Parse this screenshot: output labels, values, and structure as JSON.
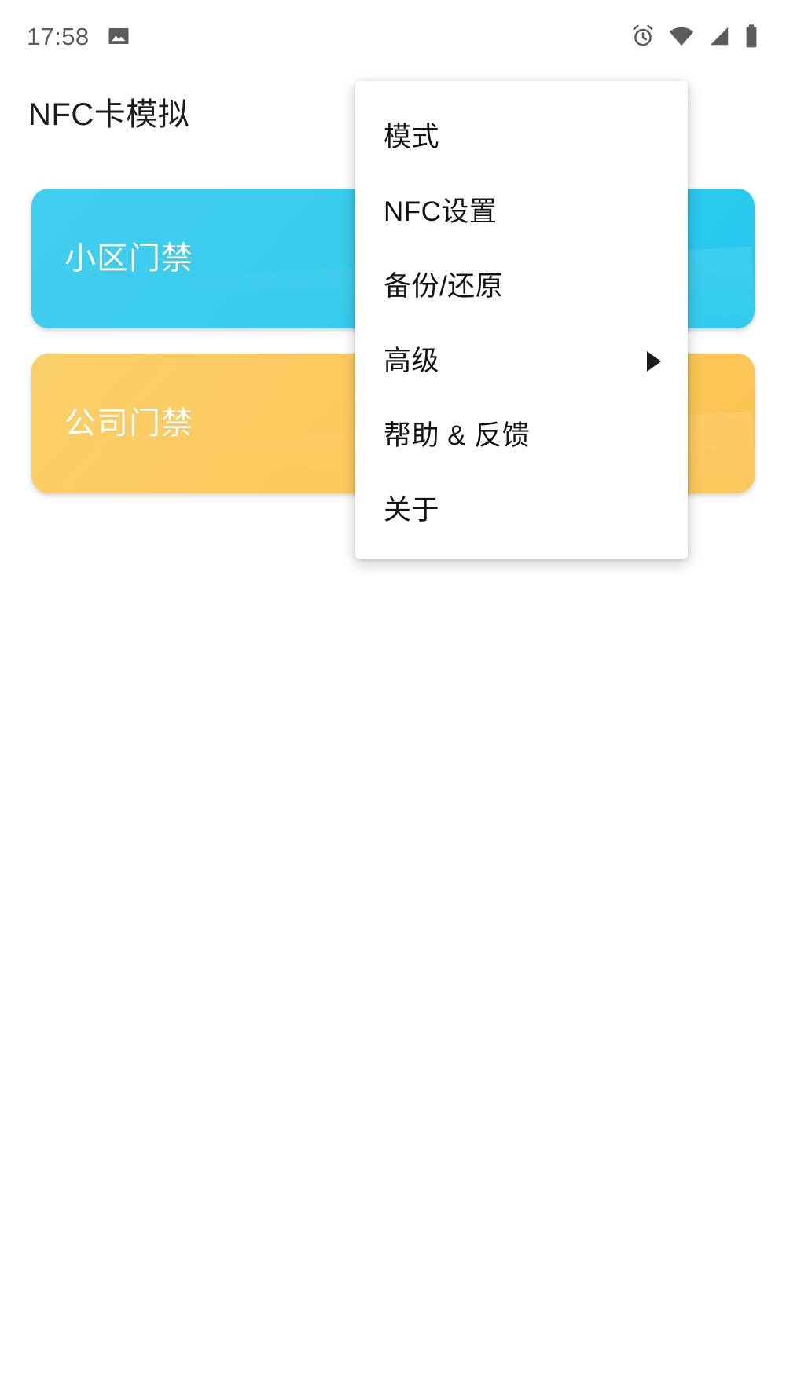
{
  "status_bar": {
    "time": "17:58",
    "left_icons": [
      {
        "name": "gallery-image-icon"
      }
    ],
    "right_icons": [
      {
        "name": "alarm-clock-icon"
      },
      {
        "name": "wifi-icon"
      },
      {
        "name": "cellular-signal-icon"
      },
      {
        "name": "battery-icon"
      }
    ],
    "icon_color": "#5c5c5c"
  },
  "app": {
    "title": "NFC卡模拟"
  },
  "cards": [
    {
      "label": "小区门禁",
      "color": "#38cbed",
      "variant": "blue"
    },
    {
      "label": "公司门禁",
      "color": "#fbcb5f",
      "variant": "yellow"
    }
  ],
  "overflow_menu": {
    "items": [
      {
        "label": "模式",
        "has_submenu": false
      },
      {
        "label": "NFC设置",
        "has_submenu": false
      },
      {
        "label": "备份/还原",
        "has_submenu": false
      },
      {
        "label": "高级",
        "has_submenu": true
      },
      {
        "label": "帮助 & 反馈",
        "has_submenu": false
      },
      {
        "label": "关于",
        "has_submenu": false
      }
    ],
    "background": "#ffffff",
    "text_color": "#141414"
  }
}
